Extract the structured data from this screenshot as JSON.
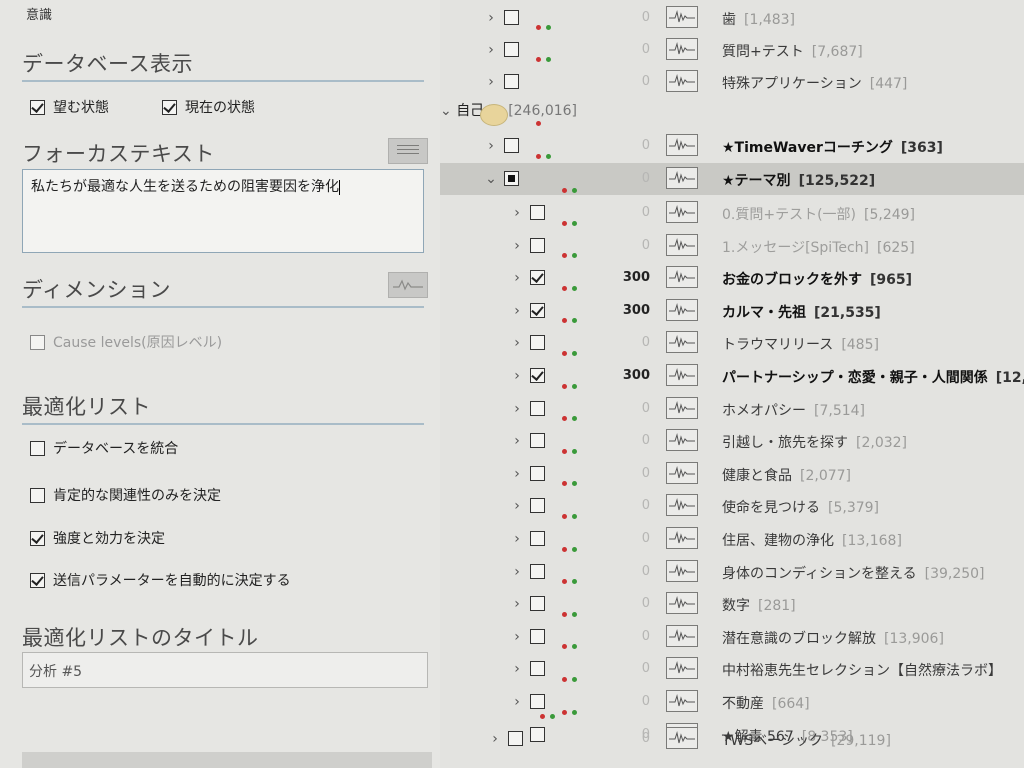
{
  "left": {
    "top_label": "意識",
    "db_display": {
      "title": "データベース表示",
      "desired": {
        "label": "望む状態",
        "checked": true
      },
      "current": {
        "label": "現在の状態",
        "checked": true
      }
    },
    "focus": {
      "title": "フォーカステキスト",
      "value": "私たちが最適な人生を送るための阻害要因を浄化"
    },
    "dimension": {
      "title": "ディメンション",
      "option": {
        "label": "Cause levels(原因レベル)",
        "checked": false
      }
    },
    "optimize": {
      "title": "最適化リスト",
      "options": [
        {
          "label": "データベースを統合",
          "checked": false
        },
        {
          "label": "肯定的な関連性のみを決定",
          "checked": false
        },
        {
          "label": "強度と効力を決定",
          "checked": true
        },
        {
          "label": "送信パラメーターを自動的に決定する",
          "checked": true
        }
      ]
    },
    "opt_title": {
      "title": "最適化リストのタイトル",
      "value": "分析 #5"
    }
  },
  "tree": {
    "top_rows": [
      {
        "name": "歯",
        "count": "[1,483]",
        "value": "0"
      },
      {
        "name": "質問+テスト",
        "count": "[7,687]",
        "value": "0"
      },
      {
        "name": "特殊アプリケーション",
        "count": "[447]",
        "value": "0"
      }
    ],
    "self": {
      "name": "自己の",
      "count": "[246,016]"
    },
    "self_children": [
      {
        "name": "★TimeWaverコーチング",
        "count": "[363]",
        "value": "0"
      },
      {
        "name": "★テーマ別",
        "count": "[125,522]",
        "value": "0"
      }
    ],
    "theme_children": [
      {
        "name": "0.質問+テスト(一部)",
        "count": "[5,249]",
        "value": "0",
        "checked": false
      },
      {
        "name": "1.メッセージ[SpiTech]",
        "count": "[625]",
        "value": "0",
        "checked": false
      },
      {
        "name": "お金のブロックを外す",
        "count": "[965]",
        "value": "300",
        "checked": true
      },
      {
        "name": "カルマ・先祖",
        "count": "[21,535]",
        "value": "300",
        "checked": true
      },
      {
        "name": "トラウマリリース",
        "count": "[485]",
        "value": "0",
        "checked": false
      },
      {
        "name": "パートナーシップ・恋愛・親子・人間関係",
        "count": "[12,",
        "value": "300",
        "checked": true
      },
      {
        "name": "ホメオパシー",
        "count": "[7,514]",
        "value": "0",
        "checked": false
      },
      {
        "name": "引越し・旅先を探す",
        "count": "[2,032]",
        "value": "0",
        "checked": false
      },
      {
        "name": "健康と食品",
        "count": "[2,077]",
        "value": "0",
        "checked": false
      },
      {
        "name": "使命を見つける",
        "count": "[5,379]",
        "value": "0",
        "checked": false
      },
      {
        "name": "住居、建物の浄化",
        "count": "[13,168]",
        "value": "0",
        "checked": false
      },
      {
        "name": "身体のコンディションを整える",
        "count": "[39,250]",
        "value": "0",
        "checked": false
      },
      {
        "name": "数字",
        "count": "[281]",
        "value": "0",
        "checked": false
      },
      {
        "name": "潜在意識のブロック解放",
        "count": "[13,906]",
        "value": "0",
        "checked": false
      },
      {
        "name": "中村裕恵先生セレクション【自然療法ラボ】",
        "count": "",
        "value": "0",
        "checked": false
      },
      {
        "name": "不動産",
        "count": "[664]",
        "value": "0",
        "checked": false
      },
      {
        "name": "★解毒 567",
        "count": "[8,353]",
        "value": "0",
        "checked": false
      }
    ],
    "bottom_row": {
      "name": "TWSベーシック",
      "count": "[29,119]",
      "value": "0"
    }
  }
}
